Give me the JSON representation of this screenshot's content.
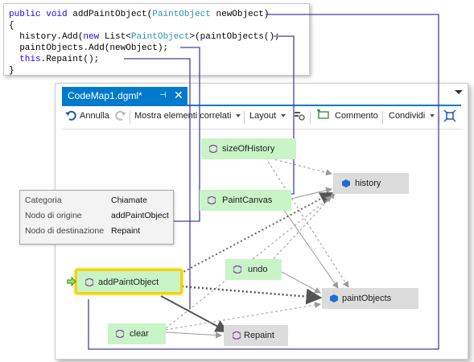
{
  "code": {
    "line1": {
      "kw1": "public",
      "kw2": "void",
      "name": "addPaintObject(",
      "type": "PaintObject",
      "rest": " newObject)"
    },
    "line2": "{",
    "line3": {
      "pre": "  history.Add(",
      "kw": "new",
      "mid": " List<",
      "type": "PaintObject",
      "rest": ">(paintObjects();"
    },
    "line4": "  paintObjects.Add(newObject);",
    "line5": {
      "kw": "  this",
      "rest": ".Repaint();"
    },
    "line6": "}"
  },
  "tab": {
    "title": "CodeMap1.dgml*",
    "pin": "⊣",
    "close": "✕"
  },
  "toolbar": {
    "undo": "Annulla",
    "show_related": "Mostra elementi correlati",
    "layout": "Layout",
    "comment": "Commento",
    "share": "Condividi"
  },
  "tooltip": {
    "k1": "Categoria",
    "v1": "Chiamate",
    "k2": "Nodo di origine",
    "v2": "addPaintObject",
    "k3": "Nodo di destinazione",
    "v3": "Repaint"
  },
  "nodes": {
    "sizeOfHistory": "sizeOfHistory",
    "history": "history",
    "paintCanvas": "PaintCanvas",
    "undo": "undo",
    "addPaintObject": "addPaintObject",
    "paintObjects": "paintObjects",
    "clear": "clear",
    "repaint": "Repaint"
  },
  "colors": {
    "accent": "#007acc",
    "node_green": "#c8f4c8",
    "node_grey": "#dcdcdc",
    "highlight": "#f3d500",
    "callout_line": "#4a3f9e"
  }
}
